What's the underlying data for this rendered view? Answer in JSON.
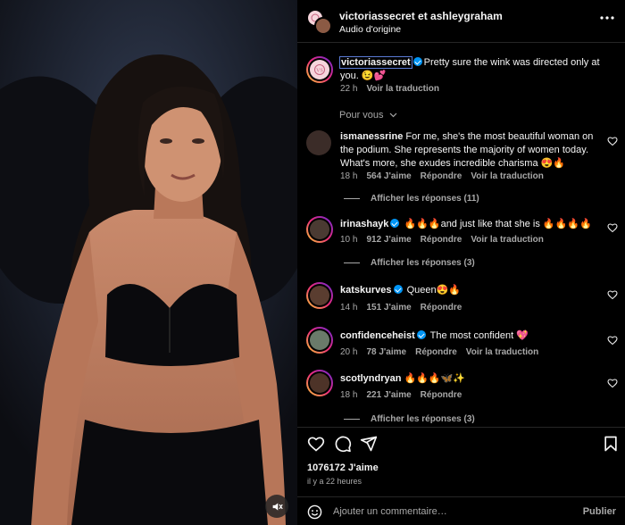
{
  "header": {
    "title": "victoriassecret et ashleygraham",
    "subtitle": "Audio d'origine",
    "more_icon": "more-horizontal-icon"
  },
  "caption": {
    "username": "victoriassecret",
    "text": "Pretty sure the wink was directed only at you. 😉💕",
    "time": "22 h",
    "translate": "Voir la traduction"
  },
  "for_you": "Pour vous",
  "comments": [
    {
      "username": "ismanessrine",
      "verified": false,
      "text": "For me, she's the most beautiful woman on the podium. She represents the majority of women today. What's more, she exudes incredible charisma 😍🔥",
      "time": "18 h",
      "likes": "564 J'aime",
      "reply": "Répondre",
      "translate": "Voir la traduction",
      "replies": "Afficher les réponses (11)"
    },
    {
      "username": "irinashayk",
      "verified": true,
      "text": "🔥🔥🔥and just like that she is 🔥🔥🔥🔥",
      "time": "10 h",
      "likes": "912 J'aime",
      "reply": "Répondre",
      "translate": "Voir la traduction",
      "replies": "Afficher les réponses (3)"
    },
    {
      "username": "katskurves",
      "verified": true,
      "text": "Queen😍🔥",
      "time": "14 h",
      "likes": "151 J'aime",
      "reply": "Répondre"
    },
    {
      "username": "confidenceheist",
      "verified": true,
      "text": "The most confident 💖",
      "time": "20 h",
      "likes": "78 J'aime",
      "reply": "Répondre",
      "translate": "Voir la traduction"
    },
    {
      "username": "scotlyndryan",
      "verified": false,
      "text": "🔥🔥🔥🦋✨",
      "time": "18 h",
      "likes": "221 J'aime",
      "reply": "Répondre",
      "replies": "Afficher les réponses (3)"
    }
  ],
  "footer": {
    "likes": "1076172 J'aime",
    "time": "il y a 22 heures",
    "comment_placeholder": "Ajouter un commentaire…",
    "publish": "Publier"
  },
  "colors": {
    "accent": "#0095f6",
    "background": "#000000",
    "muted_text": "#a8a8a8",
    "divider": "#262626"
  }
}
